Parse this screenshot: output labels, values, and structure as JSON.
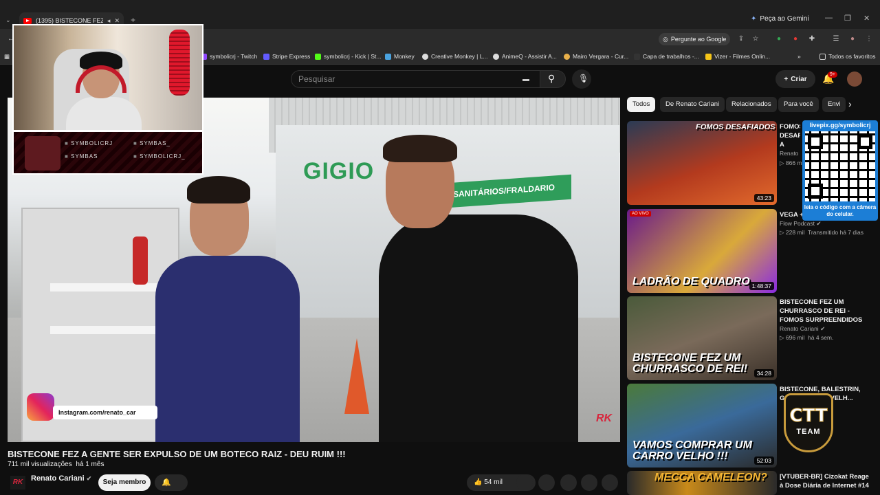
{
  "browser": {
    "tab_title": "(1395) BISTECONE FEZ A GENTE",
    "gemini_label": "Peça ao Gemini",
    "ask_google": "Pergunte ao Google",
    "bookmarks": [
      "symbolicrj - Twitch",
      "Stripe Express",
      "symbolicrj - Kick | St...",
      "Monkey",
      "Creative Monkey | L...",
      "AnimeQ - Assistir A...",
      "Mairo Vergara - Cur...",
      "Capa de trabalhos -...",
      "Vizer - Filmes Onlin..."
    ],
    "all_bookmarks": "Todos os favoritos"
  },
  "youtube": {
    "search_placeholder": "Pesquisar",
    "create_label": "Criar",
    "notif_count": "9+"
  },
  "overlay": {
    "social": [
      "SYMBOLICRJ",
      "SYMBAS_",
      "SYMBAS",
      "SYMBOLICRJ_"
    ],
    "qr_top": "livepix.gg/symbolicrj",
    "qr_bottom": "leia o código com a câmera do celular.",
    "ctt_main": "CTT",
    "ctt_sub": "TEAM"
  },
  "video": {
    "store_sign": "GIGIO",
    "banner": "SANITÁRIOS/FRALDARIO",
    "instagram": "Instagram.com/renato_car",
    "watermark": "RK",
    "title": "BISTECONE FEZ A GENTE SER EXPULSO DE UM BOTECO RAIZ - DEU RUIM !!!",
    "views": "711 mil visualizações",
    "age": "há 1 mês",
    "channel": "Renato Cariani",
    "join_label": "Seja membro",
    "likes": "54 mil"
  },
  "sidebar": {
    "chips": [
      "Todos",
      "De Renato Cariani",
      "Relacionados",
      "Para você",
      "Envi"
    ],
    "items": [
      {
        "title": "FOMOS DESAFIADOS A COMER CARANGUEJO COM A MÃO",
        "channel": "Renato Cariani",
        "views": "866 mil",
        "age": "",
        "duration": "43:23",
        "caption": "FOMOS DESAFIADOS",
        "live": ""
      },
      {
        "title": "VEGA + ...",
        "channel": "Flow Podcast",
        "views": "228 mil",
        "age": "Transmitido há 7 dias",
        "duration": "1:48:37",
        "caption": "LADRÃO DE QUADRO",
        "live": "AO VIVO"
      },
      {
        "title": "BISTECONE FEZ UM CHURRASCO DE REI - FOMOS SURPREENDIDOS !!!",
        "channel": "Renato Cariani",
        "views": "696 mil",
        "age": "há 4 sem.",
        "duration": "34:28",
        "caption": "BISTECONE FEZ UM CHURRASCO DE REI!",
        "live": ""
      },
      {
        "title": "BISTECONE, BALESTRIN, G... ...ÃO - ...RO VELH...",
        "channel": "",
        "views": "",
        "age": "",
        "duration": "52:03",
        "caption": "VAMOS COMPRAR UM CARRO VELHO !!!",
        "live": ""
      },
      {
        "title": "[VTUBER-BR] Cizokat Reage à Dose Diária de Internet #14",
        "channel": "",
        "views": "",
        "age": "",
        "duration": "",
        "caption": "MECCA CAMELEON?",
        "live": ""
      }
    ]
  }
}
